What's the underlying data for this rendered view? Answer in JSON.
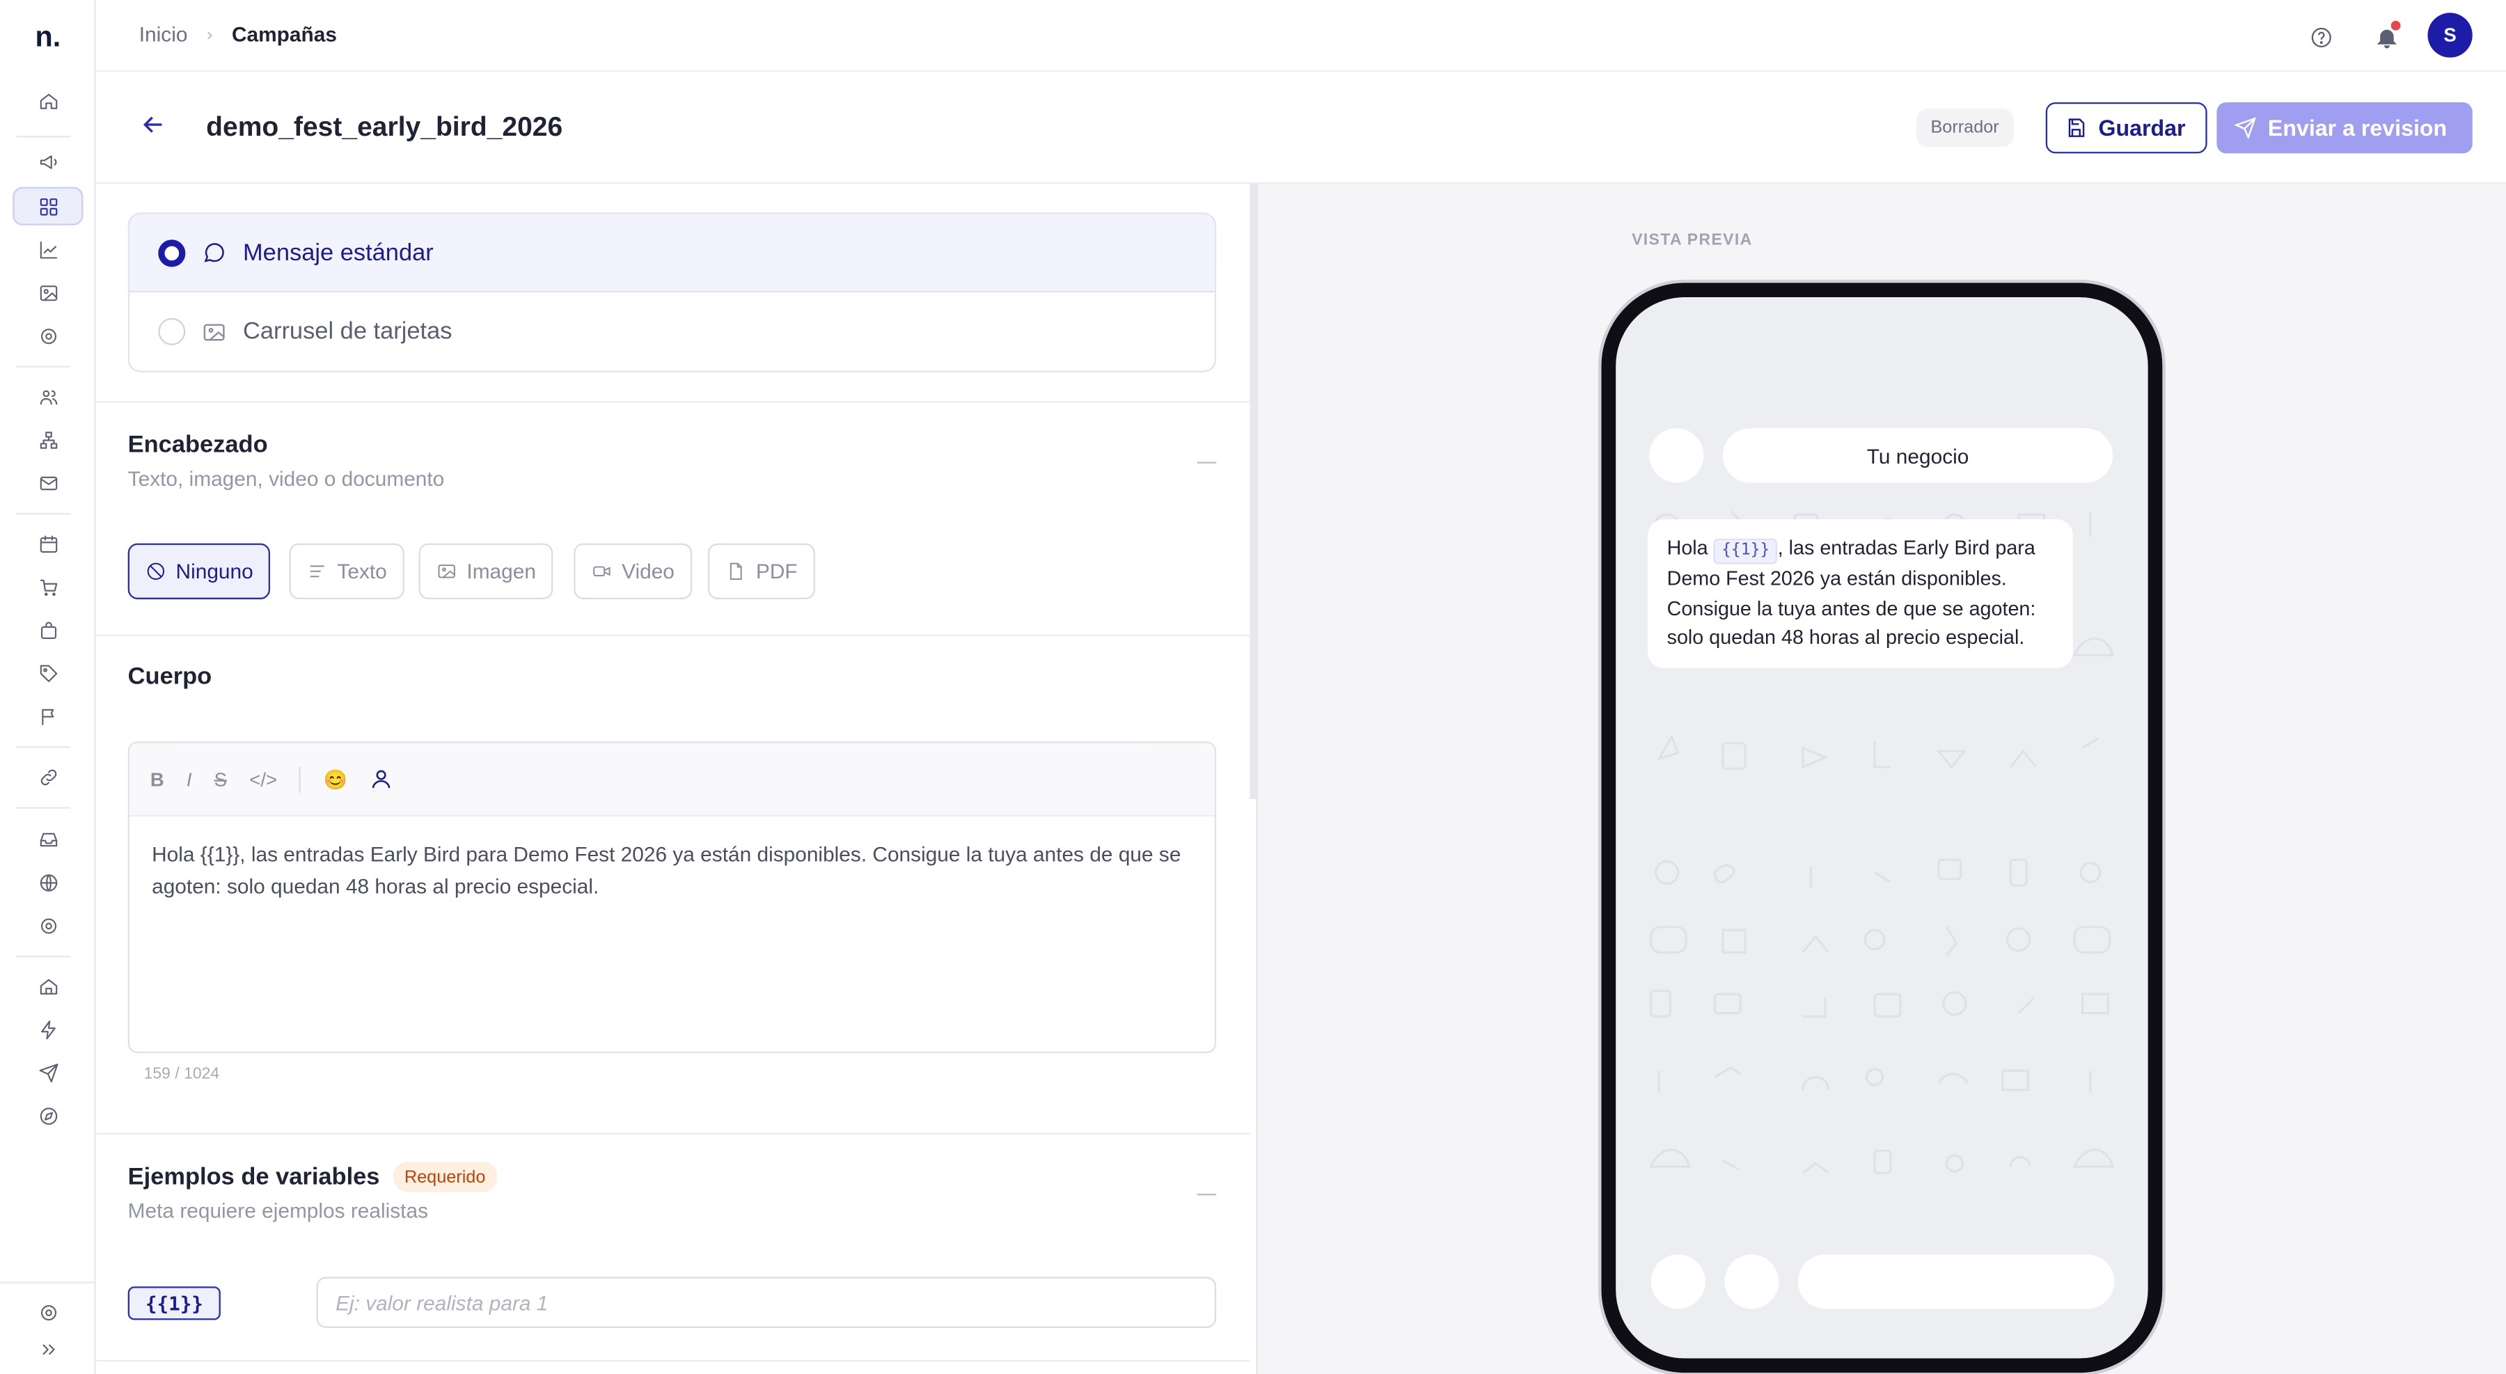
{
  "app": {
    "logo": "n.",
    "avatar_initial": "S"
  },
  "breadcrumb": {
    "home": "Inicio",
    "current": "Campañas"
  },
  "header": {
    "title": "demo_fest_early_bird_2026",
    "status": "Borrador",
    "save_label": "Guardar",
    "send_label": "Enviar a revision"
  },
  "message_type": {
    "options": [
      {
        "label": "Mensaje estándar",
        "selected": true
      },
      {
        "label": "Carrusel de tarjetas",
        "selected": false
      }
    ]
  },
  "encabezado": {
    "title": "Encabezado",
    "subtitle": "Texto, imagen, video o documento",
    "chips": [
      "Ninguno",
      "Texto",
      "Imagen",
      "Video",
      "PDF"
    ],
    "selected": "Ninguno"
  },
  "cuerpo": {
    "title": "Cuerpo",
    "toolbar": {
      "bold": "B",
      "italic": "I",
      "strike": "S",
      "code": "</>",
      "emoji": "😊"
    },
    "text": "Hola {{1}}, las entradas Early Bird para Demo Fest 2026 ya están disponibles. Consigue la tuya antes de que se agoten: solo quedan 48 horas al precio especial.",
    "counter": "159 / 1024"
  },
  "variables": {
    "title": "Ejemplos de variables",
    "badge": "Requerido",
    "subtitle": "Meta requiere ejemplos realistas",
    "var_tag": "{{1}}",
    "placeholder": "Ej: valor realista para 1"
  },
  "preview": {
    "label": "VISTA PREVIA",
    "business": "Tu negocio",
    "msg_pre": "Hola ",
    "msg_var": "{{1}}",
    "msg_post": ", las entradas Early Bird para Demo Fest 2026 ya están disponibles. Consigue la tuya antes de que se agoten: solo quedan 48 horas al precio especial."
  },
  "colors": {
    "accent": "#1c1ca8",
    "send_button": "#9f9ef0",
    "required_badge": "#c2410c"
  },
  "icons": [
    "home-icon",
    "megaphone-icon",
    "grid-icon",
    "chart-icon",
    "image-icon",
    "settings-icon",
    "users-icon",
    "sitemap-icon",
    "mail-icon",
    "calendar-icon",
    "cart-icon",
    "bag-icon",
    "tag-icon",
    "flag-icon",
    "link-icon",
    "inbox-icon",
    "globe-icon",
    "gear-icon",
    "building-icon",
    "bolt-icon",
    "send-icon",
    "compass-icon",
    "help-icon",
    "bell-icon"
  ]
}
